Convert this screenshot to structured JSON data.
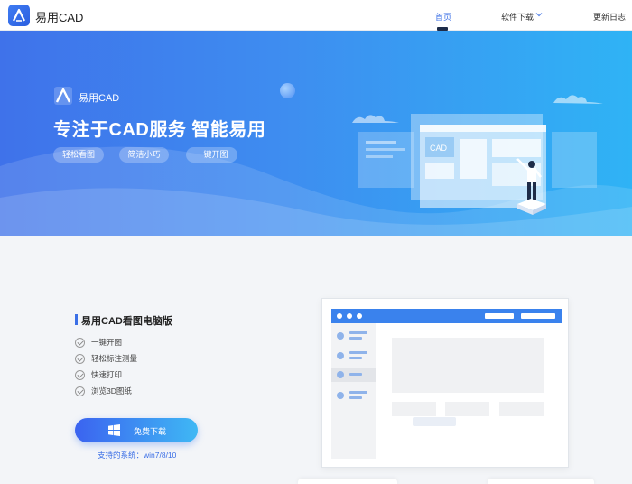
{
  "header": {
    "app_name": "易用CAD",
    "nav": [
      {
        "label": "首页",
        "active": true
      },
      {
        "label": "软件下载",
        "has_dropdown": true
      },
      {
        "label": "更新日志"
      }
    ]
  },
  "banner": {
    "brand": "易用CAD",
    "headline": "专注于CAD服务 智能易用",
    "tags": [
      "轻松看图",
      "简洁小巧",
      "一键开图"
    ],
    "illustration_label": "CAD"
  },
  "product": {
    "title": "易用CAD看图电脑版",
    "features": [
      "一键开图",
      "轻松标注测量",
      "快速打印",
      "浏览3D图纸"
    ],
    "download_label": "免费下载",
    "supported_systems": "支持的系统：win7/8/10"
  },
  "colors": {
    "brand_blue": "#3b6fe6",
    "banner_start": "#3f72ea",
    "banner_end": "#2fb3f5",
    "mock_header": "#3a82ed"
  },
  "icons": {
    "logo": "triangle-a-logo-icon",
    "dropdown": "chevron-down-icon",
    "check": "check-circle-icon",
    "windows": "windows-icon"
  }
}
